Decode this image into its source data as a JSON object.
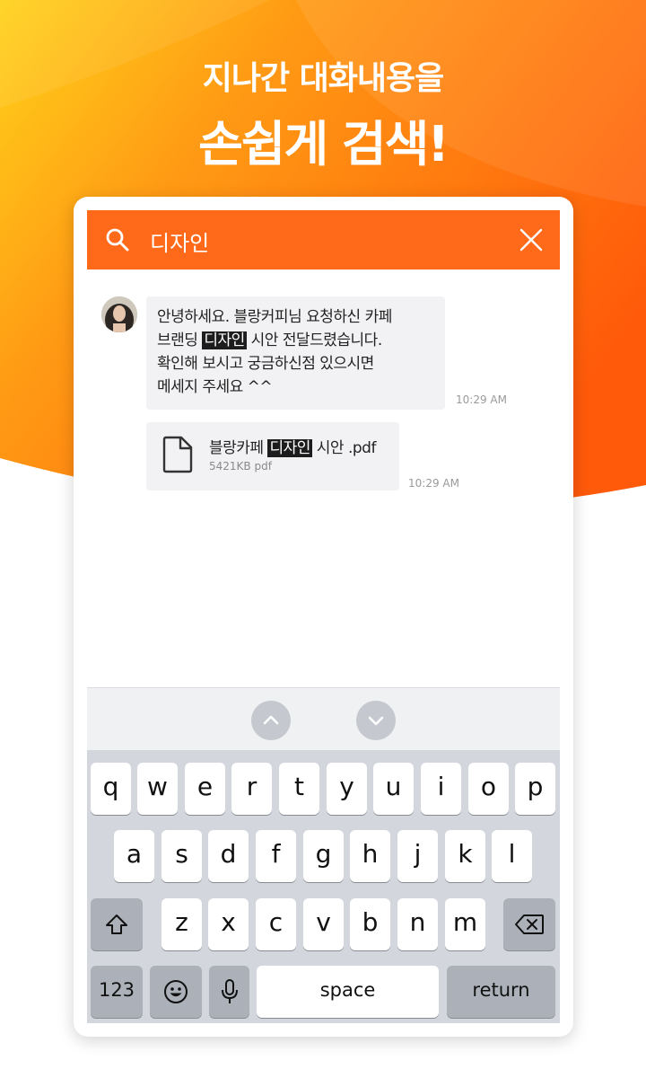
{
  "headline": {
    "line1": "지나간 대화내용을",
    "line2": "손쉽게 검색!"
  },
  "colors": {
    "brand_orange": "#ff6a1a",
    "highlight_bg": "#1d1d1d"
  },
  "search": {
    "query": "디자인",
    "search_icon": "search-icon",
    "close_icon": "close-icon"
  },
  "messages": {
    "msg1": {
      "line1": "안녕하세요. 블랑커피님 요청하신 카페",
      "line2_before": "브랜딩 ",
      "line2_highlight": "디자인",
      "line2_after": " 시안 전달드렸습니다.",
      "line3": "확인해 보시고 궁금하신점 있으시면",
      "line4": "메세지 주세요 ^^",
      "time": "10:29 AM"
    },
    "msg2": {
      "file_before": "블랑카페 ",
      "file_highlight": "디자인",
      "file_after": " 시안 .pdf",
      "file_size": "5421KB pdf",
      "time": "10:29 AM",
      "icon": "file-icon"
    }
  },
  "keyboard": {
    "row1": [
      "q",
      "w",
      "e",
      "r",
      "t",
      "y",
      "u",
      "i",
      "o",
      "p"
    ],
    "row2": [
      "a",
      "s",
      "d",
      "f",
      "g",
      "h",
      "j",
      "k",
      "l"
    ],
    "row3": [
      "z",
      "x",
      "c",
      "v",
      "b",
      "n",
      "m"
    ],
    "numbers_label": "123",
    "space_label": "space",
    "return_label": "return"
  }
}
